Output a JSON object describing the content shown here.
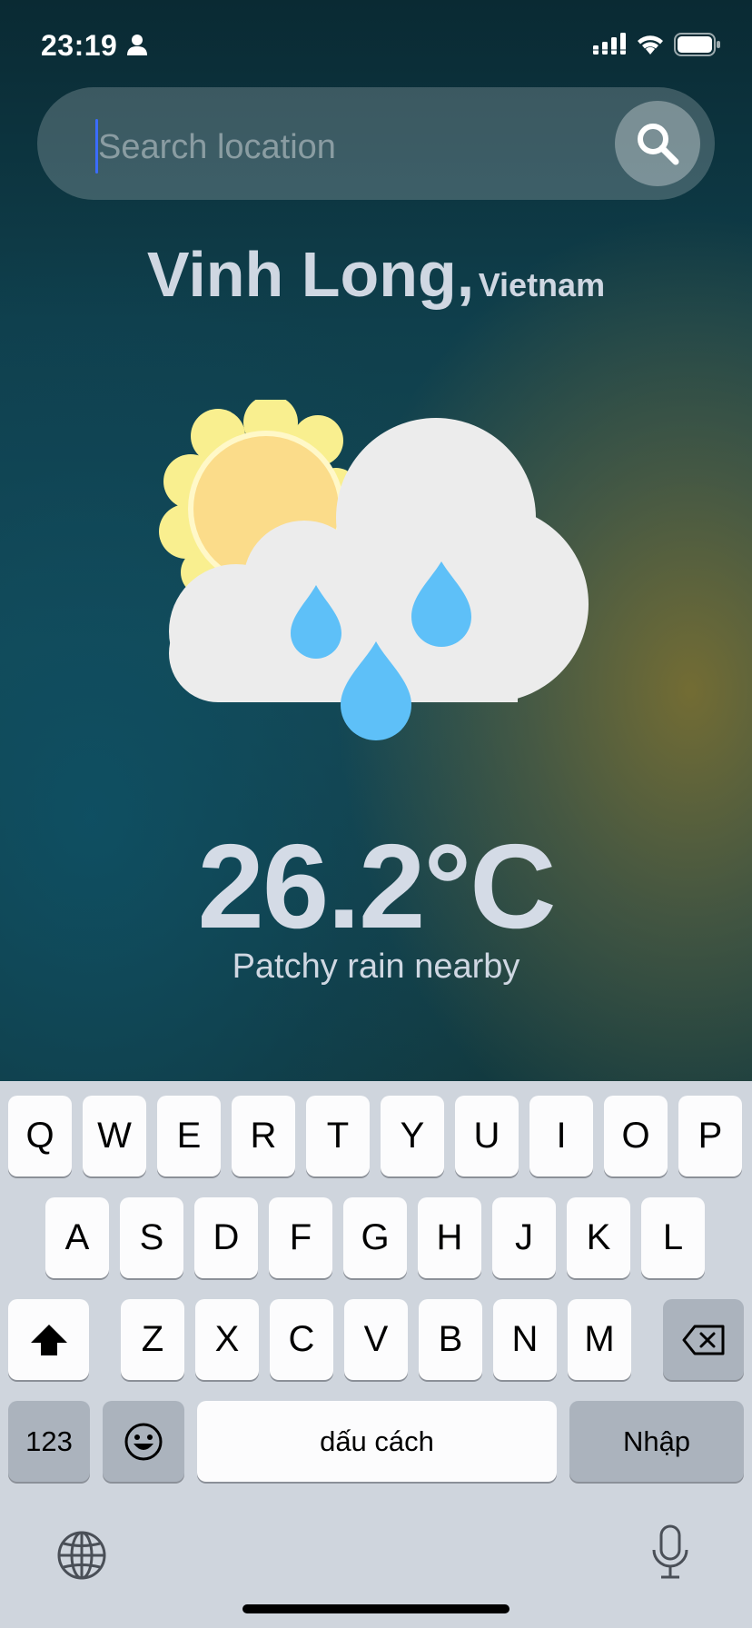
{
  "status_bar": {
    "time": "23:19"
  },
  "search": {
    "placeholder": "Search location",
    "value": ""
  },
  "location": {
    "city": "Vinh Long,",
    "country": "Vietnam"
  },
  "weather": {
    "icon": "sun-cloud-rain-icon",
    "temperature": "26.2°C",
    "condition": "Patchy rain nearby"
  },
  "keyboard": {
    "row1": [
      "Q",
      "W",
      "E",
      "R",
      "T",
      "Y",
      "U",
      "I",
      "O",
      "P"
    ],
    "row2": [
      "A",
      "S",
      "D",
      "F",
      "G",
      "H",
      "J",
      "K",
      "L"
    ],
    "row3": [
      "Z",
      "X",
      "C",
      "V",
      "B",
      "N",
      "M"
    ],
    "numbers_label": "123",
    "space_label": "dấu cách",
    "return_label": "Nhập"
  },
  "colors": {
    "caret": "#3b6cff",
    "rain": "#5ec0f8",
    "sun": "#fbdc8a",
    "cloud": "#ececec"
  }
}
